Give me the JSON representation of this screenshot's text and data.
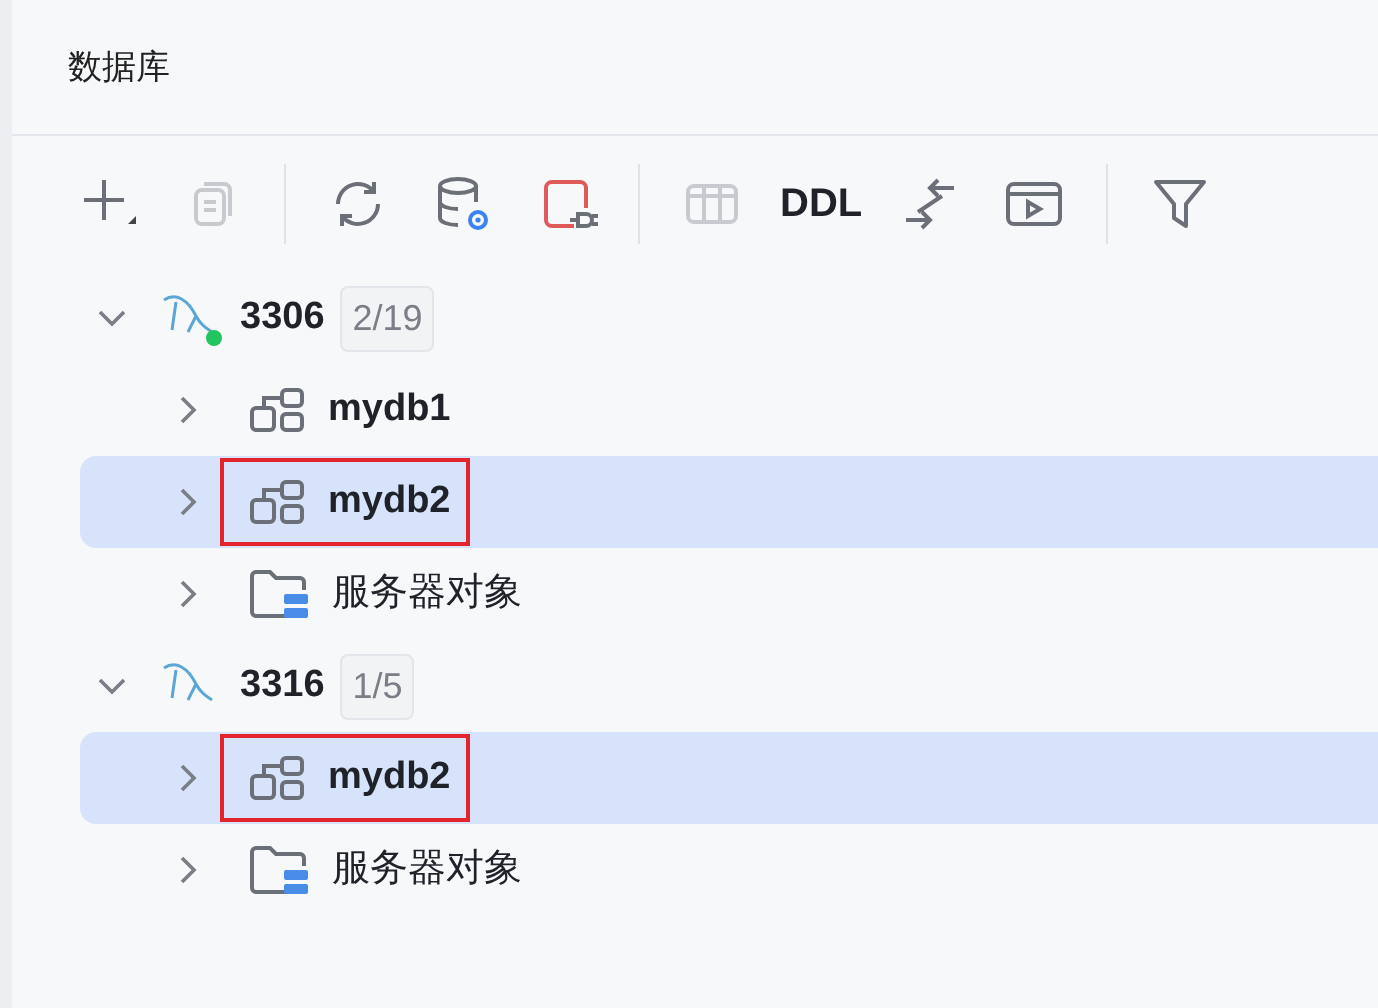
{
  "panel": {
    "title": "数据库"
  },
  "toolbar": [
    {
      "kind": "button",
      "disabled": false
    },
    {
      "kind": "button",
      "disabled": true
    },
    {
      "kind": "separator"
    },
    {
      "kind": "button",
      "disabled": false
    },
    {
      "kind": "button",
      "disabled": false
    },
    {
      "kind": "button",
      "disabled": false
    },
    {
      "kind": "separator"
    },
    {
      "kind": "button",
      "disabled": true
    },
    {
      "kind": "text",
      "label": "DDL"
    },
    {
      "kind": "button",
      "disabled": false
    },
    {
      "kind": "button",
      "disabled": false
    },
    {
      "kind": "separator"
    },
    {
      "kind": "button",
      "disabled": false
    }
  ],
  "tree": [
    {
      "name": "3306",
      "count": "2/19",
      "connected": true,
      "expanded": true,
      "children": [
        {
          "kind": "database",
          "label": "mydb1",
          "selected": false,
          "highlighted": false
        },
        {
          "kind": "database",
          "label": "mydb2",
          "selected": true,
          "highlighted": true
        },
        {
          "kind": "folder",
          "label": "服务器对象",
          "selected": false,
          "highlighted": false
        }
      ]
    },
    {
      "name": "3316",
      "count": "1/5",
      "connected": false,
      "expanded": true,
      "children": [
        {
          "kind": "database",
          "label": "mydb2",
          "selected": true,
          "highlighted": true
        },
        {
          "kind": "folder",
          "label": "服务器对象",
          "selected": false,
          "highlighted": false
        }
      ]
    }
  ]
}
